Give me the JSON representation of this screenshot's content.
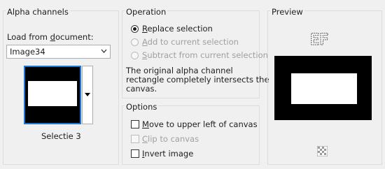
{
  "alpha": {
    "title": "Alpha channels",
    "load_label_pre": "Load from ",
    "load_label_u": "d",
    "load_label_post": "ocument:",
    "document_value": "Image34",
    "selection_name": "Selectie 3"
  },
  "operation": {
    "title": "Operation",
    "replace": {
      "u": "R",
      "rest": "eplace selection"
    },
    "add": {
      "u": "A",
      "rest": "dd to current selection"
    },
    "subtract": {
      "u": "S",
      "rest": "ubtract from current selection"
    },
    "info": [
      "The original alpha channel",
      "rectangle completely intersects the",
      "canvas."
    ]
  },
  "options": {
    "title": "Options",
    "move": {
      "u": "M",
      "rest": "ove to upper left of canvas"
    },
    "clip": {
      "u": "C",
      "rest": "lip to canvas"
    },
    "invert": {
      "u": "I",
      "rest": "nvert image"
    }
  },
  "preview": {
    "title": "Preview",
    "logo_text": "EF"
  },
  "colors": {
    "accent": "#1e78d2",
    "background": "#f0f0f0"
  }
}
